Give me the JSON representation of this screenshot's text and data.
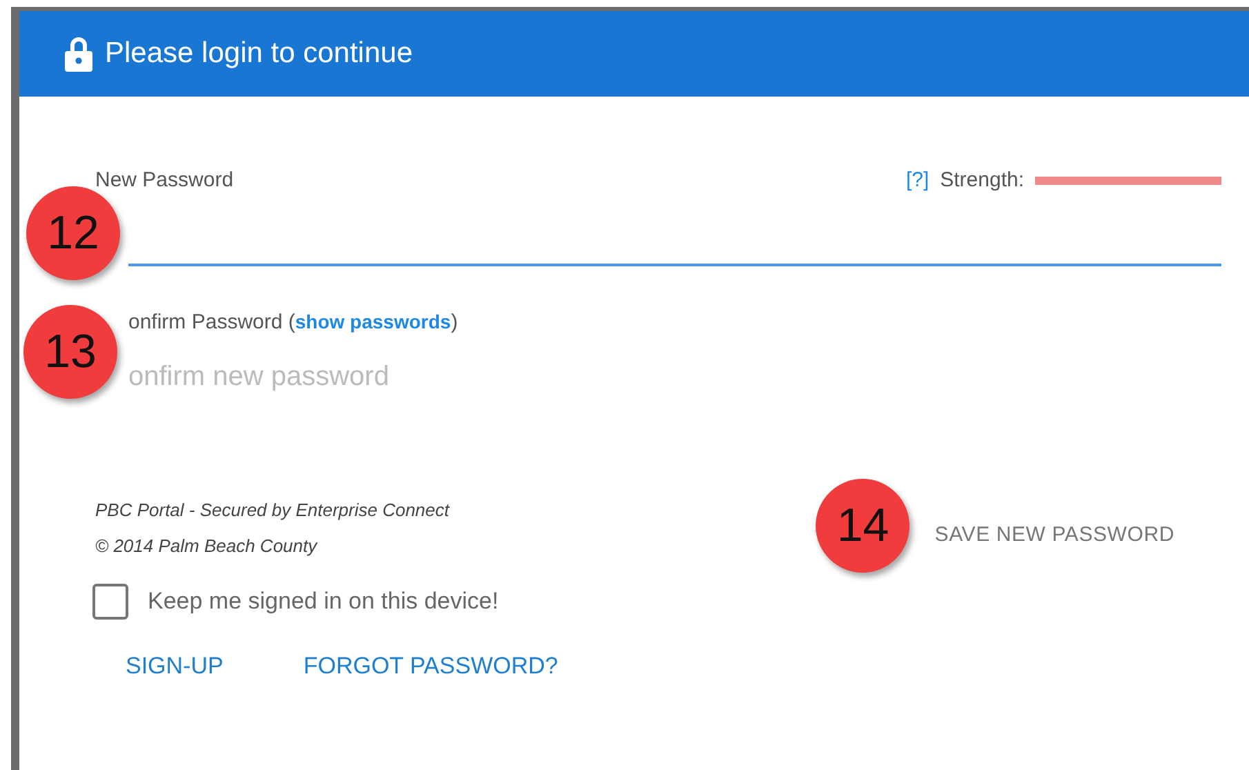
{
  "header": {
    "title": "Please login to continue"
  },
  "new_password": {
    "label": "New Password",
    "help": "[?]",
    "strength_label": "Strength:",
    "strength": {
      "level": 1
    },
    "callout": "12"
  },
  "confirm_password": {
    "label": "onfirm Password (",
    "link": "show passwords",
    "label_end": ")",
    "placeholder": "onfirm new password",
    "callout": "13"
  },
  "footer": {
    "lines": [
      "PBC Portal - Secured by Enterprise Connect",
      "© 2014 Palm Beach County"
    ],
    "save_button": "SAVE NEW PASSWORD",
    "callout": "14"
  },
  "keep_signed_in": {
    "label": "Keep me signed in on this device!",
    "checked": false
  },
  "links": [
    "SIGN-UP",
    "FORGOT PASSWORD?"
  ]
}
